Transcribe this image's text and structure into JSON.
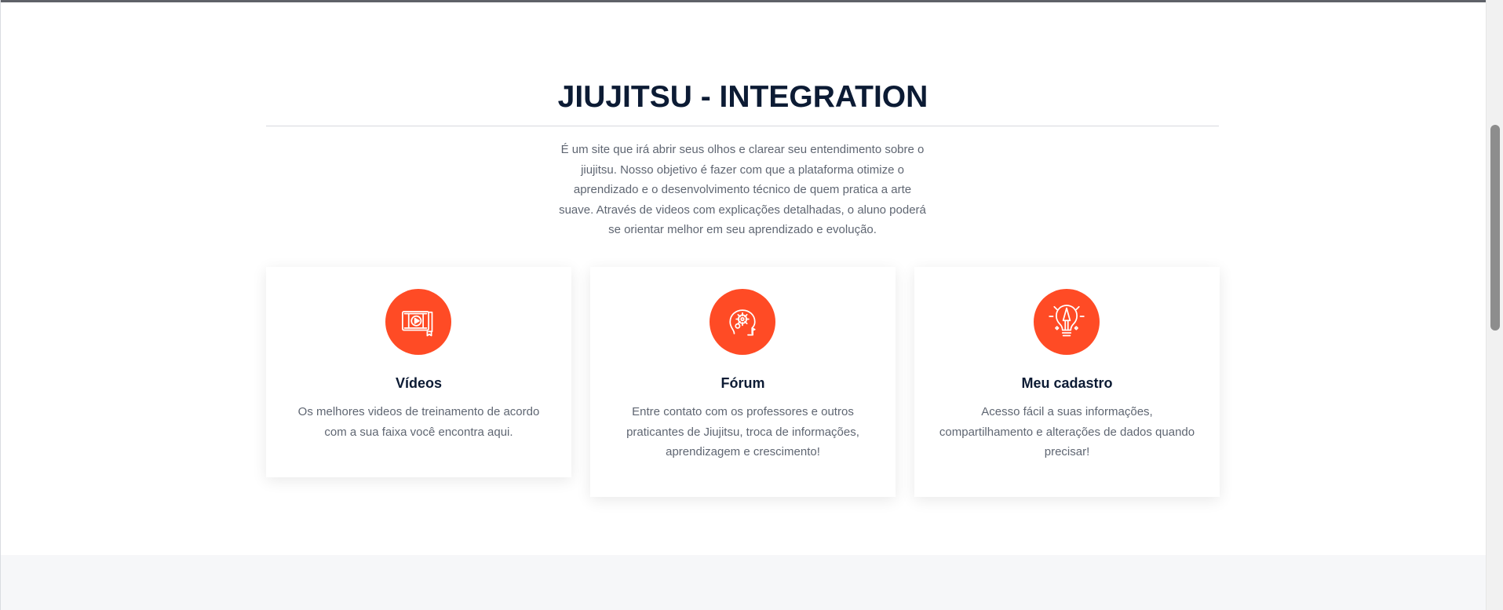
{
  "colors": {
    "title": "#0c1b34",
    "body_text": "#5f6672",
    "accent": "#ff4b25",
    "card_bg": "#ffffff",
    "page_bg": "#ffffff",
    "footer_bg": "#f6f7f9"
  },
  "section": {
    "title": "JIUJITSU - INTEGRATION",
    "description": "É um site que irá abrir seus olhos e clarear seu entendimento sobre o jiujitsu. Nosso objetivo é fazer com que a plataforma otimize o aprendizado e o desenvolvimento técnico de quem pratica a arte suave. Através de videos com explicações detalhadas, o aluno poderá se orientar melhor em seu aprendizado e evolução."
  },
  "cards": [
    {
      "icon": "video-player-icon",
      "title": "Vídeos",
      "text": "Os melhores videos de treinamento de acordo com a sua faixa você encontra aqui."
    },
    {
      "icon": "brain-gears-icon",
      "title": "Fórum",
      "text": "Entre contato com os professores e outros praticantes de Jiujitsu, troca de informações, aprendizagem e crescimento!"
    },
    {
      "icon": "idea-bulb-icon",
      "title": "Meu cadastro",
      "text": "Acesso fácil a suas informações, compartilhamento e alterações de dados quando precisar!"
    }
  ]
}
